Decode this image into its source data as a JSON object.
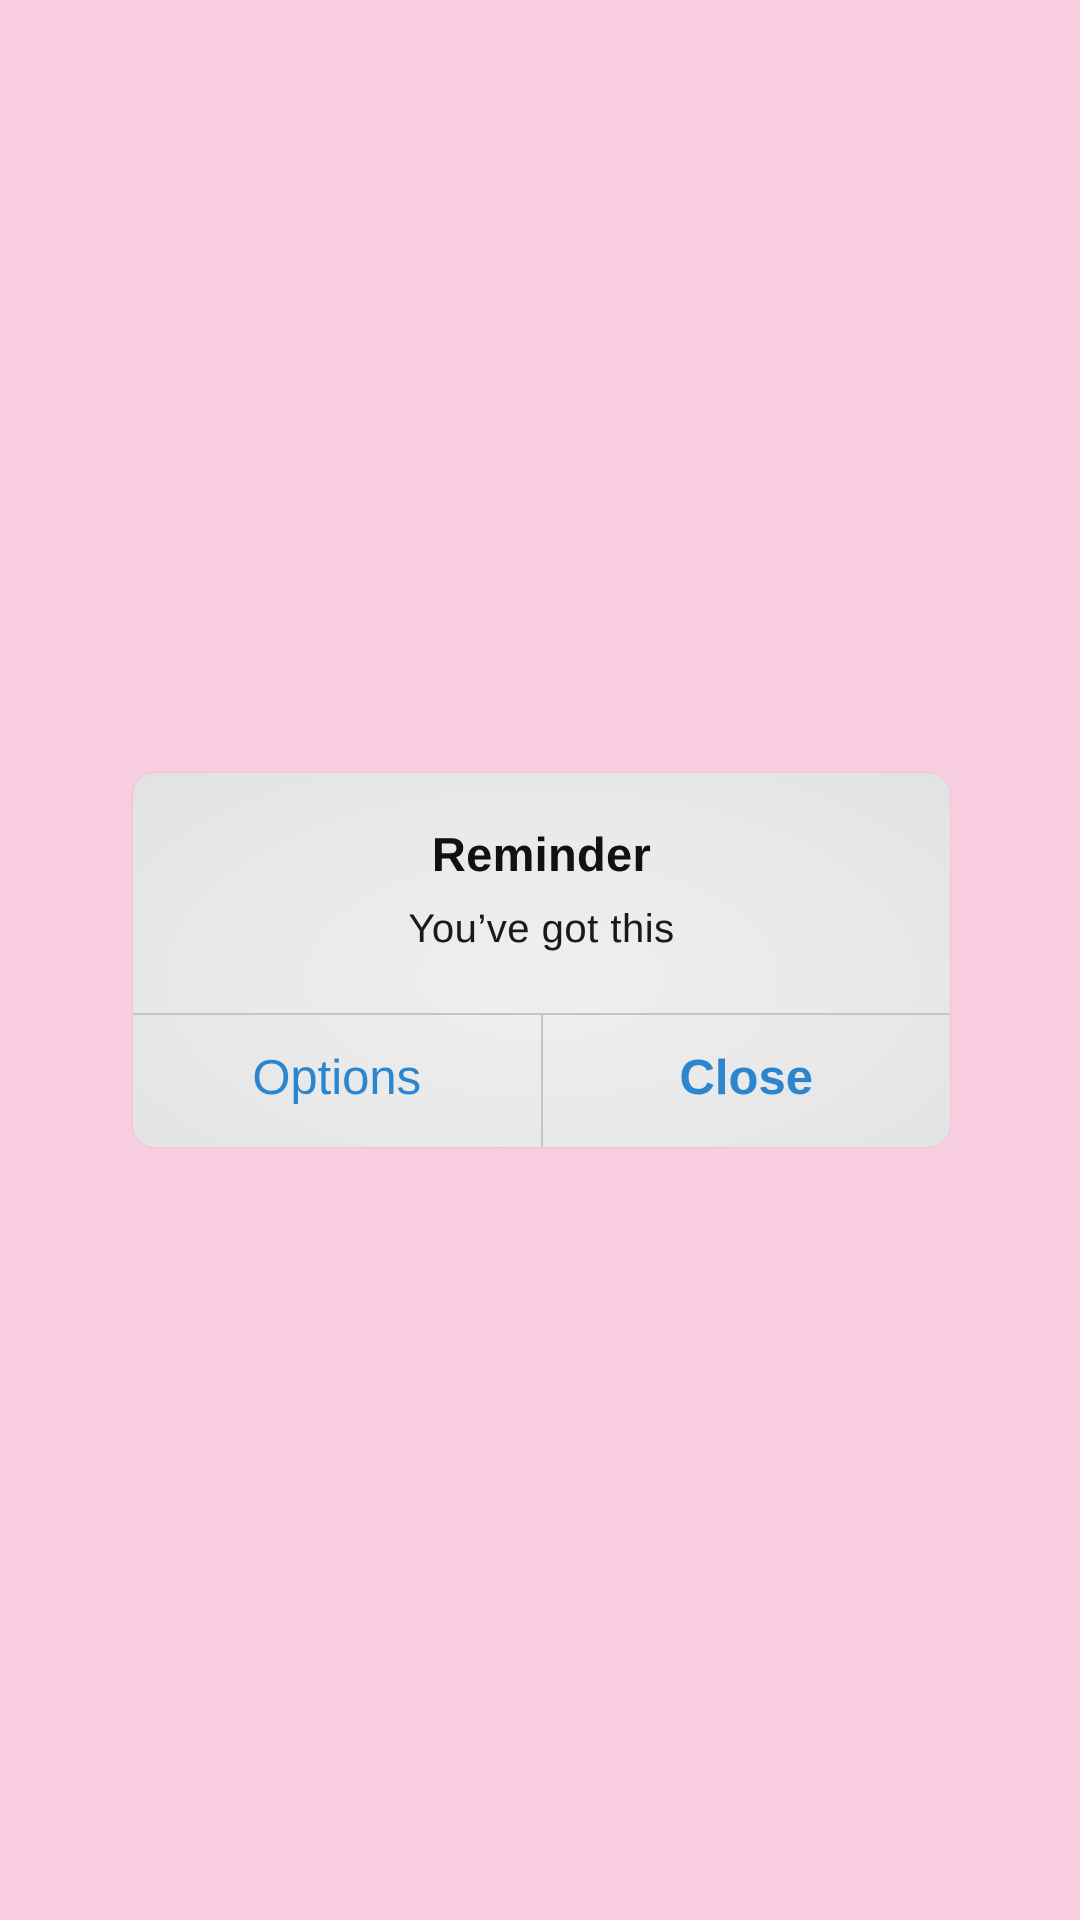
{
  "theme": {
    "background": "#f8cddf",
    "accent": "#2c86cf",
    "alert_background": "#e9e9e9"
  },
  "alert": {
    "title": "Reminder",
    "message": "You’ve got this",
    "buttons": {
      "options_label": "Options",
      "close_label": "Close"
    }
  }
}
